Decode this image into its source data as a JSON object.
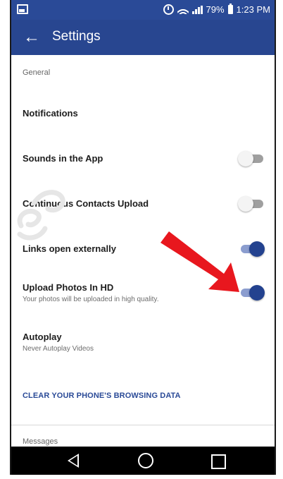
{
  "status_bar": {
    "battery_percent": "79%",
    "time": "1:23 PM"
  },
  "app_bar": {
    "title": "Settings"
  },
  "sections": {
    "general_header": "General",
    "messages_header": "Messages"
  },
  "items": {
    "notifications": {
      "title": "Notifications"
    },
    "sounds": {
      "title": "Sounds in the App",
      "enabled": false
    },
    "contacts_upload": {
      "title": "Continuous Contacts Upload",
      "enabled": false
    },
    "links_external": {
      "title": "Links open externally",
      "enabled": true
    },
    "upload_hd": {
      "title": "Upload Photos In HD",
      "subtitle": "Your photos will be uploaded in high quality.",
      "enabled": true
    },
    "autoplay": {
      "title": "Autoplay",
      "subtitle": "Never Autoplay Videos"
    },
    "clear_data": {
      "label": "CLEAR YOUR PHONE'S BROWSING DATA"
    }
  },
  "colors": {
    "brand_blue": "#2a4a97",
    "toggle_on_knob": "#23428f",
    "toggle_on_track": "#8b9dcf",
    "toggle_off_track": "#9f9f9f",
    "annotation_arrow": "#e8171e"
  },
  "icons": {
    "status_left": "image-notification-icon",
    "alarm": "alarm-icon",
    "wifi": "wifi-icon",
    "signal": "signal-icon",
    "battery": "battery-icon",
    "back": "back-arrow-icon",
    "nav_back": "nav-back-icon",
    "nav_home": "nav-home-icon",
    "nav_recent": "nav-recent-apps-icon"
  }
}
